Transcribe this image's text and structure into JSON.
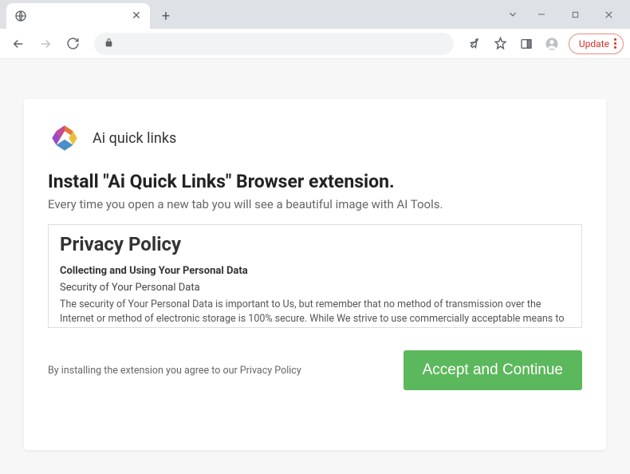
{
  "window": {
    "chevron": "⌄",
    "minimize": "—",
    "maximize": "□",
    "close": "✕"
  },
  "tab": {
    "close": "✕",
    "new": "+"
  },
  "toolbar": {
    "update_label": "Update"
  },
  "page": {
    "logo_text": "Ai quick links",
    "heading": "Install \"Ai Quick Links\" Browser extension.",
    "subheading": "Every time you open a new tab you will see a beautiful image with AI Tools.",
    "policy": {
      "title": "Privacy Policy",
      "section": "Collecting and Using Your Personal Data",
      "sub": "Security of Your Personal Data",
      "body": "The security of Your Personal Data is important to Us, but remember that no method of transmission over the Internet or method of electronic storage is 100% secure. While We strive to use commercially acceptable means to protect Your Personal Data, We cannot guarantee its absolute security."
    },
    "disclaimer": "By installing the extension you agree to our Privacy Policy",
    "accept_label": "Accept and Continue"
  },
  "colors": {
    "accept_bg": "#5cb85c",
    "update_border": "#ea8a7f",
    "update_text": "#d93025"
  }
}
